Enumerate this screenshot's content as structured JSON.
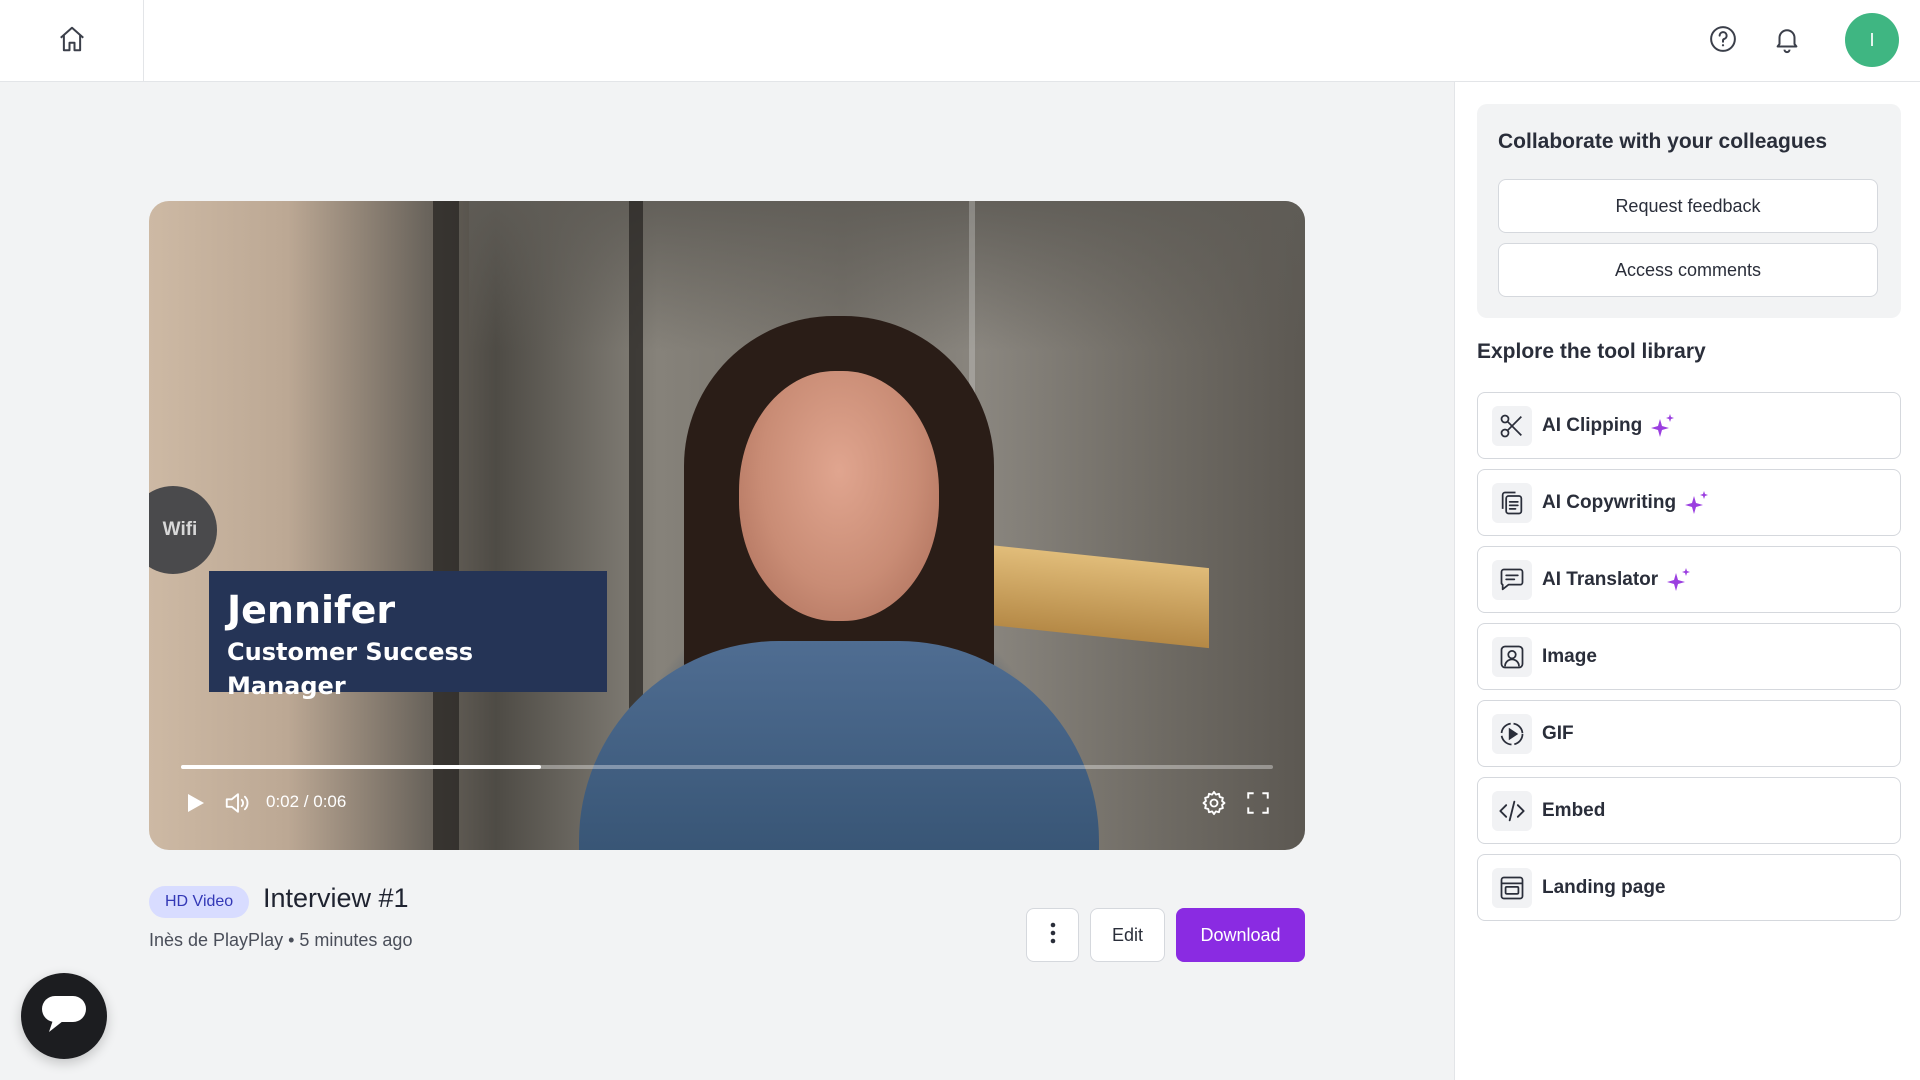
{
  "topbar": {
    "home_icon": "home-icon",
    "help_icon": "help-circle-icon",
    "notifications_icon": "bell-icon",
    "avatar_initial": "I",
    "avatar_color": "#3fb682"
  },
  "player": {
    "overlay_badge": "Wifi",
    "lower_third": {
      "name": "Jennifer",
      "role": "Customer Success Manager",
      "background": "#253456"
    },
    "time_display": "0:02 / 0:06",
    "progress_fraction": 0.33,
    "controls": [
      "play-icon",
      "volume-icon",
      "settings-gear-icon",
      "fullscreen-icon"
    ]
  },
  "video_meta": {
    "badge": "HD Video",
    "title": "Interview #1",
    "subtitle": "Inès de PlayPlay • 5 minutes ago"
  },
  "actions": {
    "more_icon": "more-vertical-icon",
    "edit_label": "Edit",
    "download_label": "Download",
    "download_color": "#8a2be2"
  },
  "sidebar": {
    "collaborate": {
      "title": "Collaborate with your colleagues",
      "request_feedback": "Request feedback",
      "access_comments": "Access comments"
    },
    "library_title": "Explore the tool library",
    "tools": [
      {
        "label": "AI Clipping",
        "icon": "scissors-icon",
        "ai": true
      },
      {
        "label": "AI Copywriting",
        "icon": "copy-text-icon",
        "ai": true
      },
      {
        "label": "AI Translator",
        "icon": "chat-translate-icon",
        "ai": true
      },
      {
        "label": "Image",
        "icon": "image-portrait-icon",
        "ai": false
      },
      {
        "label": "GIF",
        "icon": "gif-play-icon",
        "ai": false
      },
      {
        "label": "Embed",
        "icon": "code-icon",
        "ai": false
      },
      {
        "label": "Landing page",
        "icon": "landing-page-icon",
        "ai": false
      }
    ],
    "sparkle_color": "#9b3fe0"
  },
  "chat": {
    "icon": "chat-bubble-icon"
  }
}
